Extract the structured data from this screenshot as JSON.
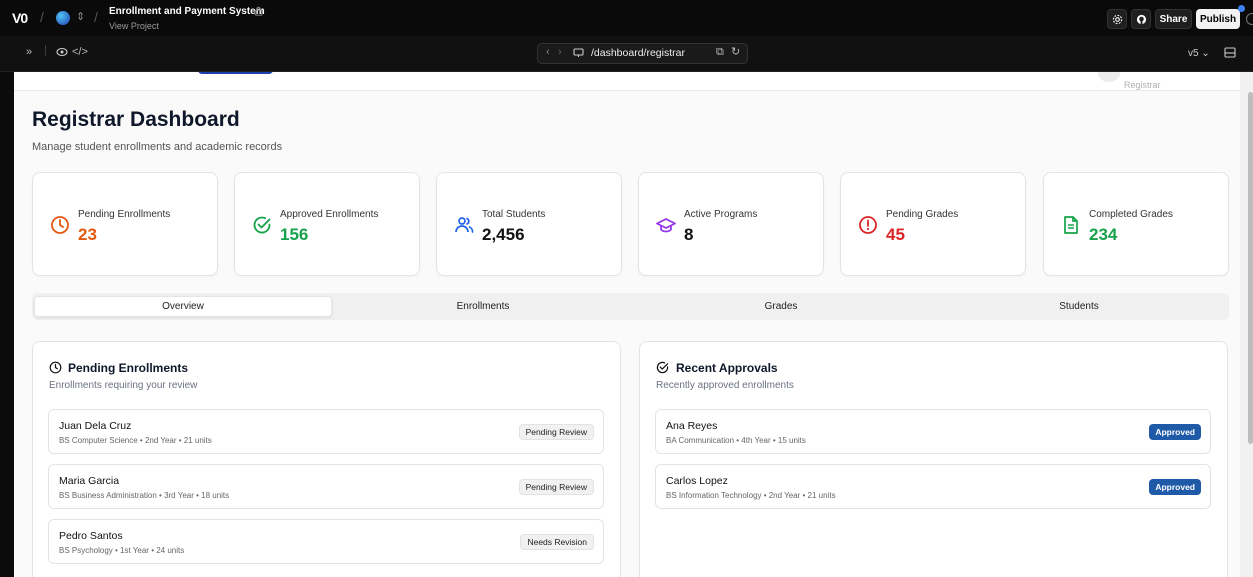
{
  "app": {
    "logo": "V0",
    "project_title": "Enrollment and Payment System",
    "project_sub": "View Project",
    "share_label": "Share",
    "publish_label": "Publish",
    "url": "/dashboard/registrar",
    "version": "v5"
  },
  "page": {
    "header_role_fragment": "Registrar",
    "title": "Registrar Dashboard",
    "subtitle": "Manage student enrollments and academic records"
  },
  "stats": [
    {
      "label": "Pending Enrollments",
      "value": "23",
      "icon": "clock-icon",
      "color": "#e4570f"
    },
    {
      "label": "Approved Enrollments",
      "value": "156",
      "icon": "check-circle-icon",
      "color": "#16a34a"
    },
    {
      "label": "Total Students",
      "value": "2,456",
      "icon": "users-icon",
      "color": "#2563eb"
    },
    {
      "label": "Active Programs",
      "value": "8",
      "icon": "graduation-cap-icon",
      "color": "#9333ea"
    },
    {
      "label": "Pending Grades",
      "value": "45",
      "icon": "alert-circle-icon",
      "color": "#dc2626"
    },
    {
      "label": "Completed Grades",
      "value": "234",
      "icon": "file-text-icon",
      "color": "#16a34a"
    }
  ],
  "tabs": [
    {
      "label": "Overview",
      "active": true
    },
    {
      "label": "Enrollments",
      "active": false
    },
    {
      "label": "Grades",
      "active": false
    },
    {
      "label": "Students",
      "active": false
    }
  ],
  "pending": {
    "title": "Pending Enrollments",
    "subtitle": "Enrollments requiring your review",
    "items": [
      {
        "name": "Juan Dela Cruz",
        "detail": "BS Computer Science • 2nd Year • 21 units",
        "status": "Pending Review"
      },
      {
        "name": "Maria Garcia",
        "detail": "BS Business Administration • 3rd Year • 18 units",
        "status": "Pending Review"
      },
      {
        "name": "Pedro Santos",
        "detail": "BS Psychology • 1st Year • 24 units",
        "status": "Needs Revision"
      }
    ]
  },
  "recent": {
    "title": "Recent Approvals",
    "subtitle": "Recently approved enrollments",
    "items": [
      {
        "name": "Ana Reyes",
        "detail": "BA Communication • 4th Year • 15 units",
        "status": "Approved"
      },
      {
        "name": "Carlos Lopez",
        "detail": "BS Information Technology • 2nd Year • 21 units",
        "status": "Approved"
      }
    ]
  },
  "colors": {
    "accent_blue": "#1e5aa8",
    "orange": "#e4570f",
    "green": "#16a34a",
    "purple": "#9333ea",
    "red": "#dc2626"
  }
}
